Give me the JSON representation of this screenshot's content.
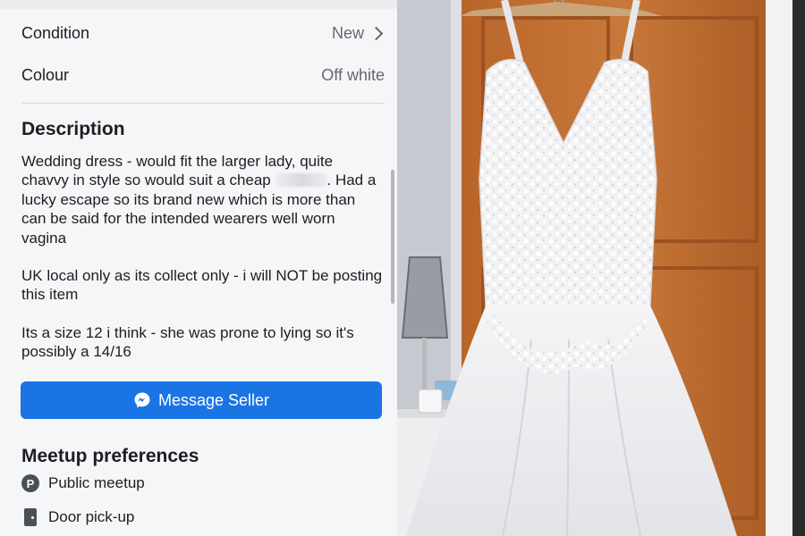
{
  "listing": {
    "condition_label": "Condition",
    "condition_value": "New",
    "colour_label": "Colour",
    "colour_value": "Off white",
    "description_heading": "Description",
    "description_p1_a": "Wedding dress - would fit the larger lady, quite chavvy in style so would suit a cheap",
    "description_p1_b": ". Had a lucky escape so its brand new which is more than can be said for the intended wearers well worn vagina",
    "description_p2": "UK local only as its collect only - i will NOT be posting this item",
    "description_p3": "Its a size 12 i think - she was prone to lying so it's possibly a 14/16",
    "message_button": "Message Seller",
    "meetup_heading": "Meetup preferences",
    "meetup_options": [
      "Public meetup",
      "Door pick-up"
    ]
  },
  "colors": {
    "accent": "#1b74e4",
    "panel_bg": "#f5f6f8"
  },
  "icons": [
    "chevron-right-icon",
    "messenger-icon",
    "parking-icon",
    "door-icon"
  ]
}
